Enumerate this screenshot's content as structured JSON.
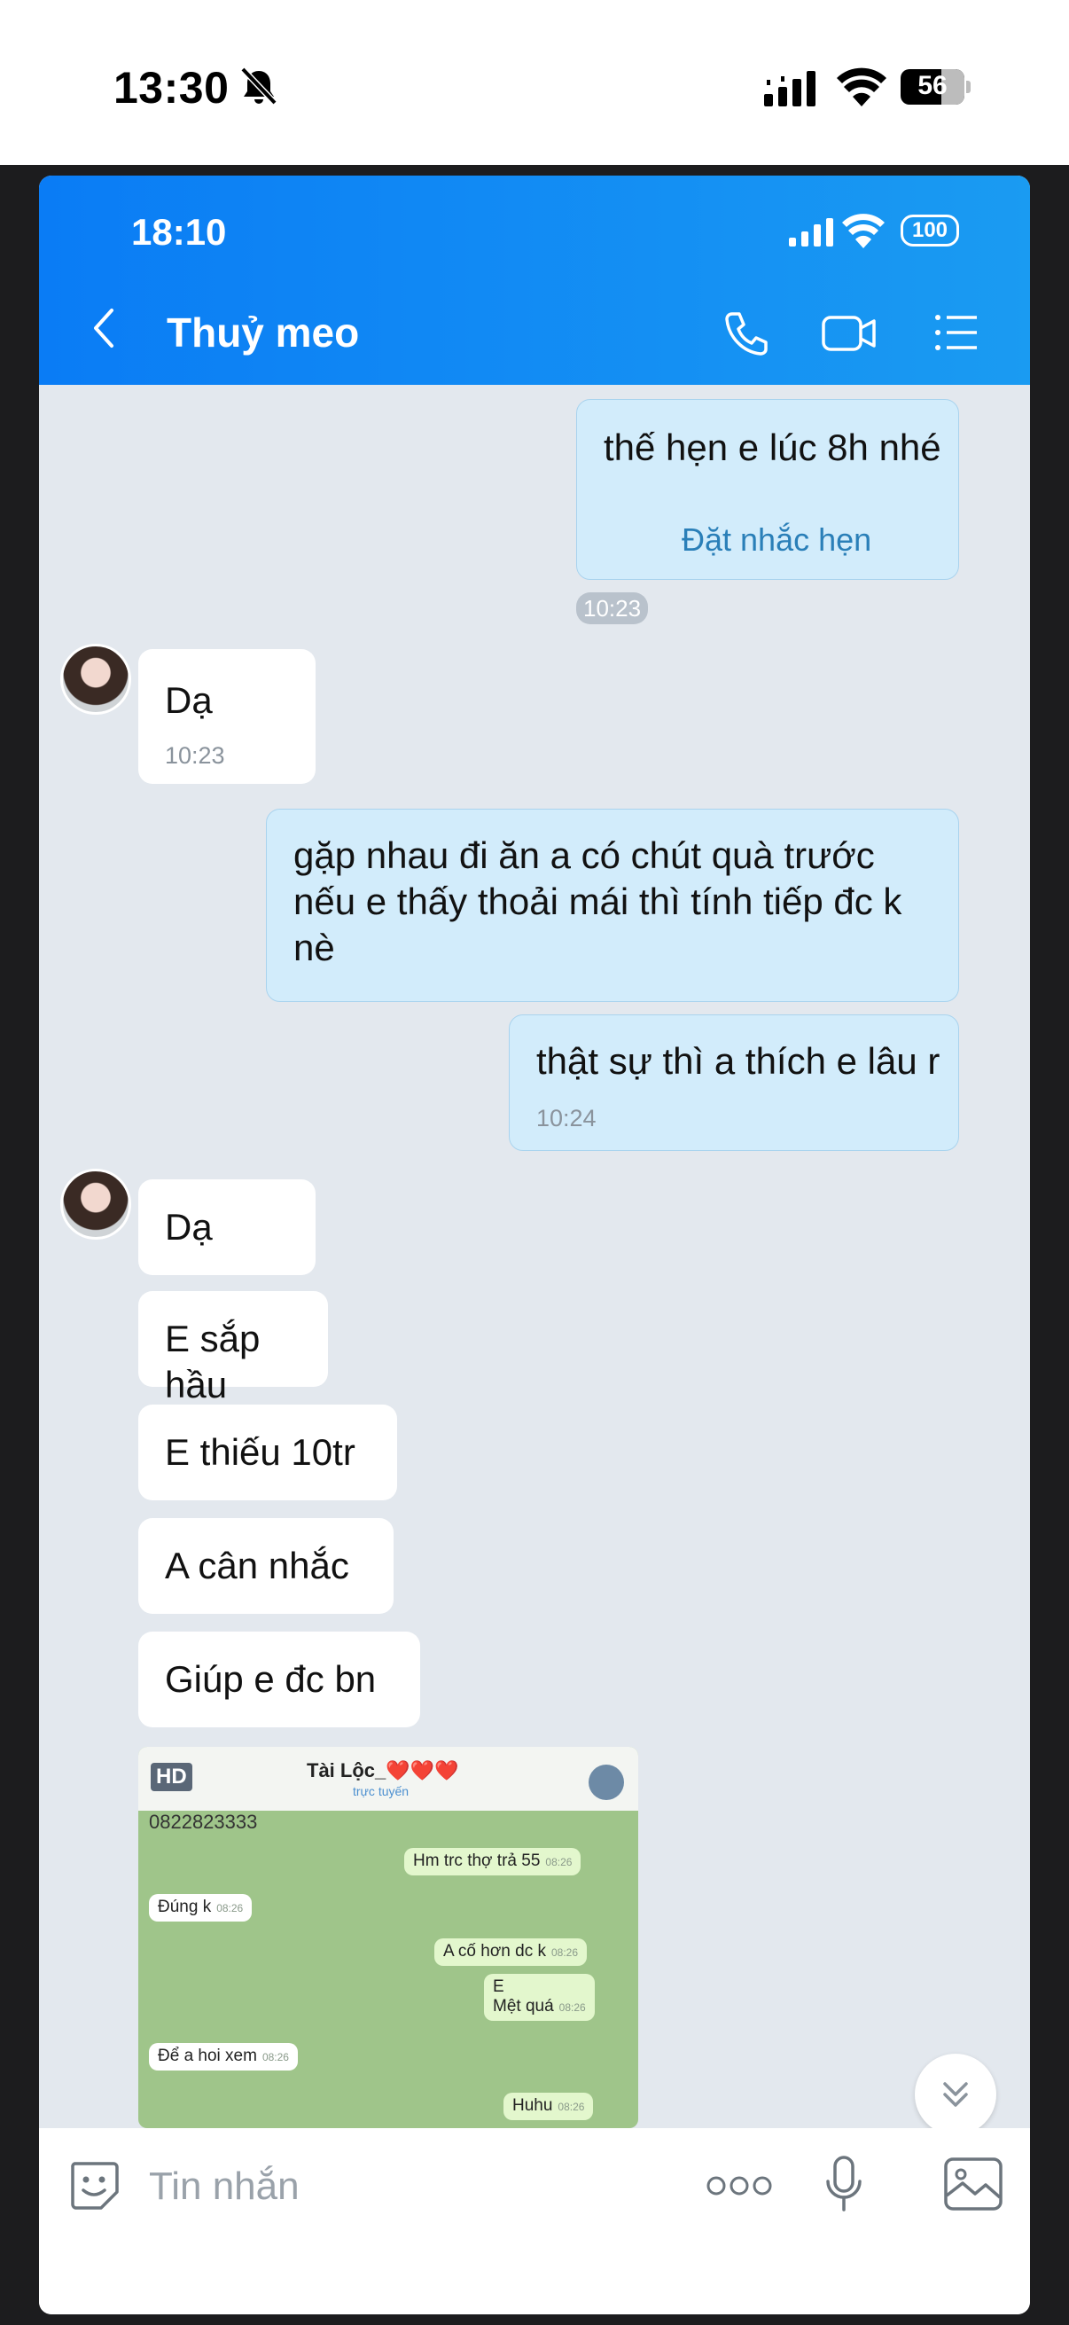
{
  "outer_status": {
    "time": "13:30",
    "battery": "56"
  },
  "inner_status": {
    "time": "18:10",
    "battery": "100"
  },
  "header": {
    "contact_name": "Thuỷ meo"
  },
  "messages": {
    "m1": {
      "text": "thế hẹn e lúc 8h nhé",
      "action": "Đặt nhắc hẹn",
      "time": "10:23"
    },
    "m2": {
      "text": "Dạ",
      "time": "10:23"
    },
    "m3": {
      "line1": "gặp nhau đi ăn a có chút quà trước",
      "line2": "nếu e thấy thoải mái thì tính tiếp đc k",
      "line3": "nè"
    },
    "m4": {
      "text": "thật sự thì a thích e lâu r",
      "time": "10:24"
    },
    "m5": {
      "text": "Dạ"
    },
    "m6": {
      "text": "E sắp hầu"
    },
    "m7": {
      "text": "E thiếu 10tr"
    },
    "m8": {
      "text": "A cân nhắc"
    },
    "m9": {
      "text": "Giúp e đc bn"
    }
  },
  "attachment": {
    "badge": "HD",
    "title": "Tài Lộc_❤️❤️❤️",
    "subtitle": "trực tuyến",
    "top_number": "0822823333",
    "chat": [
      {
        "side": "right",
        "text": "Hm trc thợ trả 55",
        "time": "08:26"
      },
      {
        "side": "left",
        "text": "Đúng k",
        "time": "08:26"
      },
      {
        "side": "right",
        "text": "A cố hơn dc k",
        "time": "08:26"
      },
      {
        "side": "right",
        "text": "E",
        "text2": "Mệt quá",
        "time": "08:26"
      },
      {
        "side": "left",
        "text": "Để a hoi xem",
        "time": "08:26"
      },
      {
        "side": "right",
        "text": "Huhu",
        "time": "08:26"
      }
    ]
  },
  "composer": {
    "placeholder": "Tin nhắn"
  },
  "colors": {
    "header_start": "#0a7cf5",
    "header_end": "#1a9bf2",
    "my_bubble": "#d2ecfb",
    "chat_bg": "#e3e8ee"
  }
}
